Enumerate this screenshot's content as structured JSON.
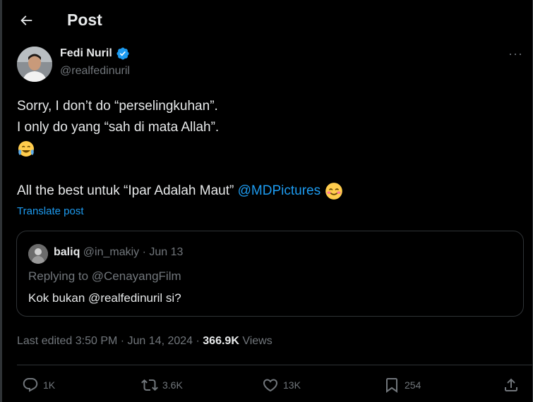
{
  "header": {
    "title": "Post"
  },
  "author": {
    "name": "Fedi Nuril",
    "handle": "@realfedinuril",
    "verified": true
  },
  "tweet": {
    "line1": "Sorry, I don’t do “perselingkuhan”.",
    "line2": "I only do yang “sah di mata Allah”.",
    "line4_text": "All the best untuk “Ipar Adalah Maut” ",
    "line4_mention": "@MDPictures",
    "translate_label": "Translate post"
  },
  "quote": {
    "name": "baliq",
    "meta": "@in_makiy · Jun 13",
    "replying_to": "Replying to @CenayangFilm",
    "text": "Kok bukan @realfedinuril si?"
  },
  "meta": {
    "edited": "Last edited 3:50 PM · Jun 14, 2024 · ",
    "views_count": "366.9K",
    "views_label": " Views"
  },
  "actions": {
    "replies": "1K",
    "reposts": "3.6K",
    "likes": "13K",
    "bookmarks": "254"
  },
  "colors": {
    "accent": "#1d9bf0",
    "muted": "#71767b",
    "text": "#e7e9ea",
    "border": "#2f3336",
    "background": "#000000"
  },
  "icons": [
    "back-arrow-icon",
    "verified-badge-icon",
    "more-icon",
    "crying-laughing-emoji",
    "smiling-emoji",
    "reply-icon",
    "repost-icon",
    "like-icon",
    "bookmark-icon",
    "share-icon"
  ]
}
